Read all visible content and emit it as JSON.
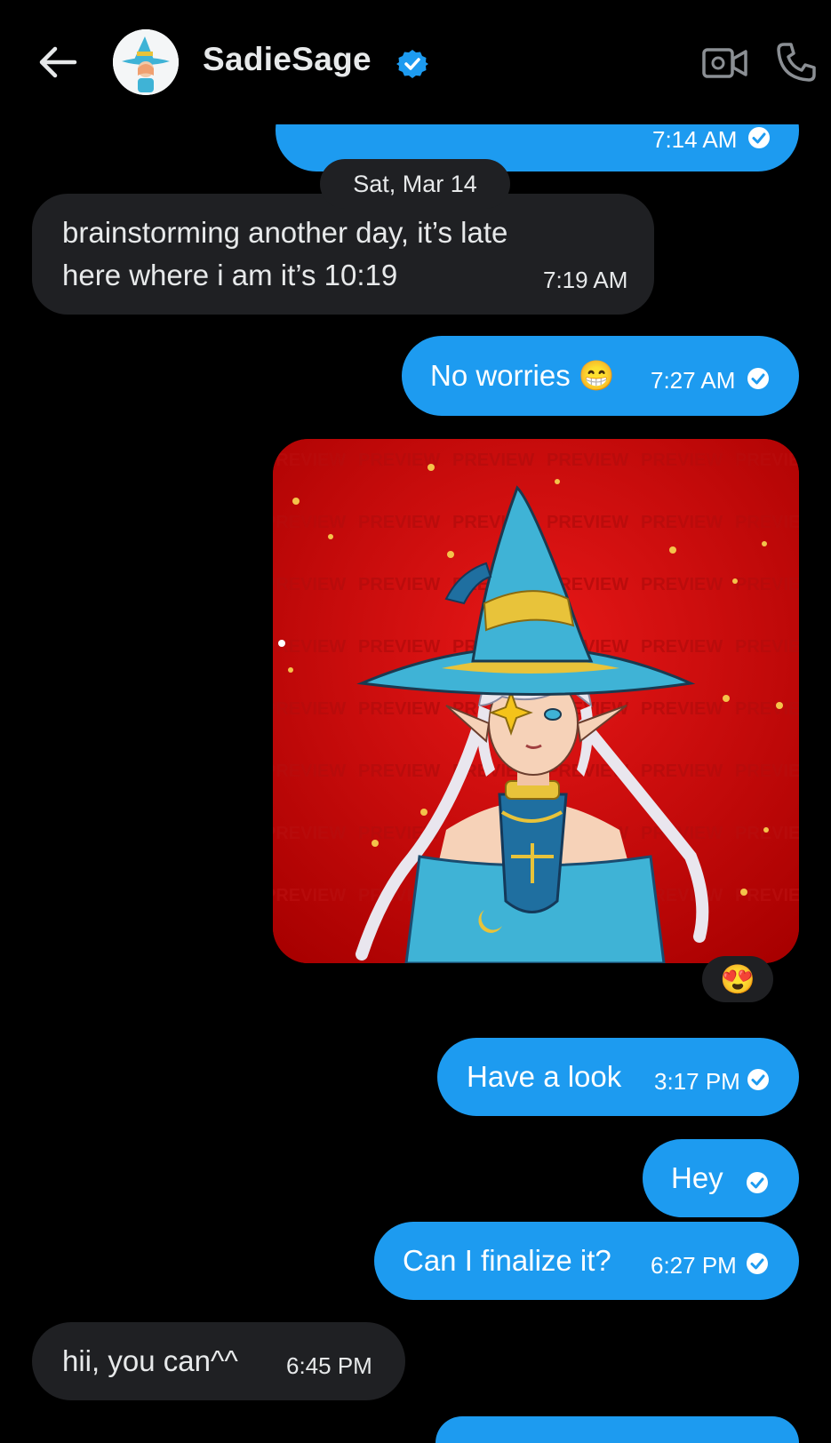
{
  "header": {
    "contact_name": "SadieSage",
    "back_icon": "arrow-left-icon",
    "verified_icon": "verified-badge-icon",
    "video_icon": "video-call-icon",
    "call_icon": "phone-icon"
  },
  "date_separator": "Sat, Mar 14",
  "messages": [
    {
      "direction": "out",
      "text": "",
      "time": "7:14 AM",
      "read": true
    },
    {
      "direction": "in",
      "lines": [
        "brainstorming another day, it’s late",
        "here where i am it’s 10:19"
      ],
      "time": "7:19 AM"
    },
    {
      "direction": "out",
      "text": "No worries 😁",
      "time": "7:27 AM",
      "read": true
    },
    {
      "direction": "out",
      "type": "image",
      "image_description": "witch-character-artwork",
      "watermark": "PREVIEW",
      "reaction": "😍"
    },
    {
      "direction": "out",
      "text": "Have a look",
      "time": "3:17 PM",
      "read": true
    },
    {
      "direction": "out",
      "text": "Hey",
      "time": "",
      "read": true
    },
    {
      "direction": "out",
      "text": "Can I finalize it?",
      "time": "6:27 PM",
      "read": true
    },
    {
      "direction": "in",
      "text": "hii, you can^^",
      "time": "6:45 PM"
    }
  ],
  "colors": {
    "background": "#000000",
    "outgoing_bubble": "#1d9bf0",
    "incoming_bubble": "#1f2023",
    "image_background": "#d10d0d",
    "hat": "#3fb3d6"
  }
}
